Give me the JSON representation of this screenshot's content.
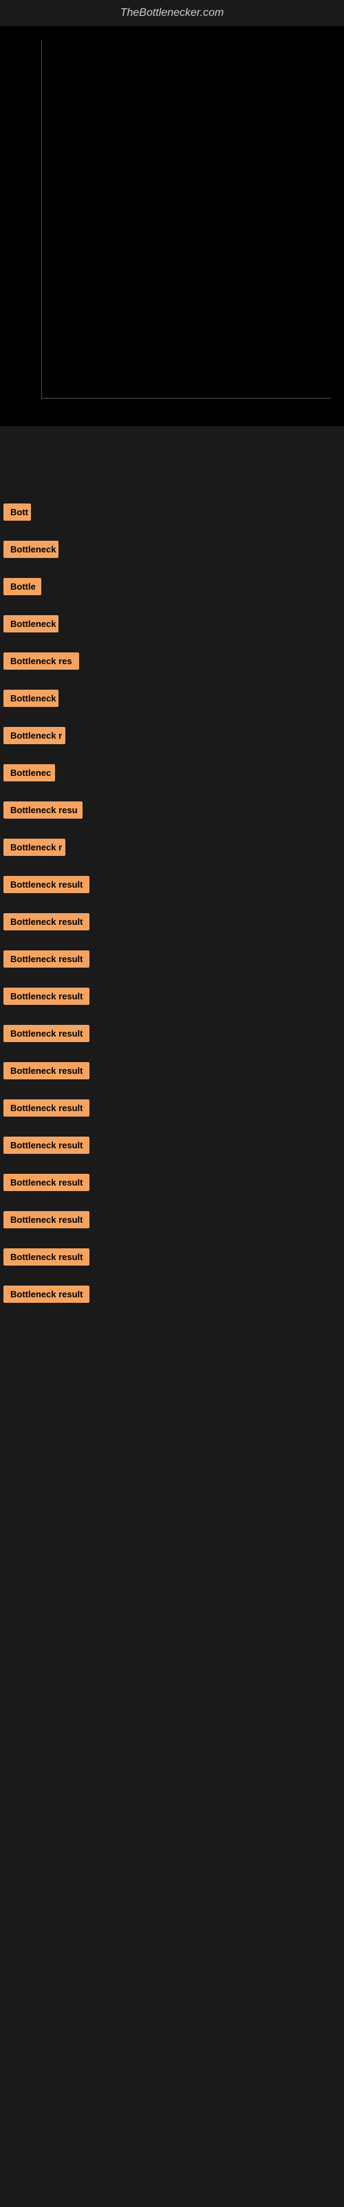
{
  "site": {
    "title": "TheBottlenecker.com"
  },
  "results": [
    {
      "label": "Bott",
      "width": 40
    },
    {
      "label": "Bottleneck",
      "width": 80
    },
    {
      "label": "Bottle",
      "width": 55
    },
    {
      "label": "Bottleneck",
      "width": 80
    },
    {
      "label": "Bottleneck res",
      "width": 110
    },
    {
      "label": "Bottleneck",
      "width": 80
    },
    {
      "label": "Bottleneck r",
      "width": 90
    },
    {
      "label": "Bottlenec",
      "width": 75
    },
    {
      "label": "Bottleneck resu",
      "width": 115
    },
    {
      "label": "Bottleneck r",
      "width": 90
    },
    {
      "label": "Bottleneck result",
      "width": 130
    },
    {
      "label": "Bottleneck result",
      "width": 130
    },
    {
      "label": "Bottleneck result",
      "width": 130
    },
    {
      "label": "Bottleneck result",
      "width": 130
    },
    {
      "label": "Bottleneck result",
      "width": 130
    },
    {
      "label": "Bottleneck result",
      "width": 130
    },
    {
      "label": "Bottleneck result",
      "width": 130
    },
    {
      "label": "Bottleneck result",
      "width": 130
    },
    {
      "label": "Bottleneck result",
      "width": 130
    },
    {
      "label": "Bottleneck result",
      "width": 130
    },
    {
      "label": "Bottleneck result",
      "width": 130
    },
    {
      "label": "Bottleneck result",
      "width": 130
    }
  ]
}
